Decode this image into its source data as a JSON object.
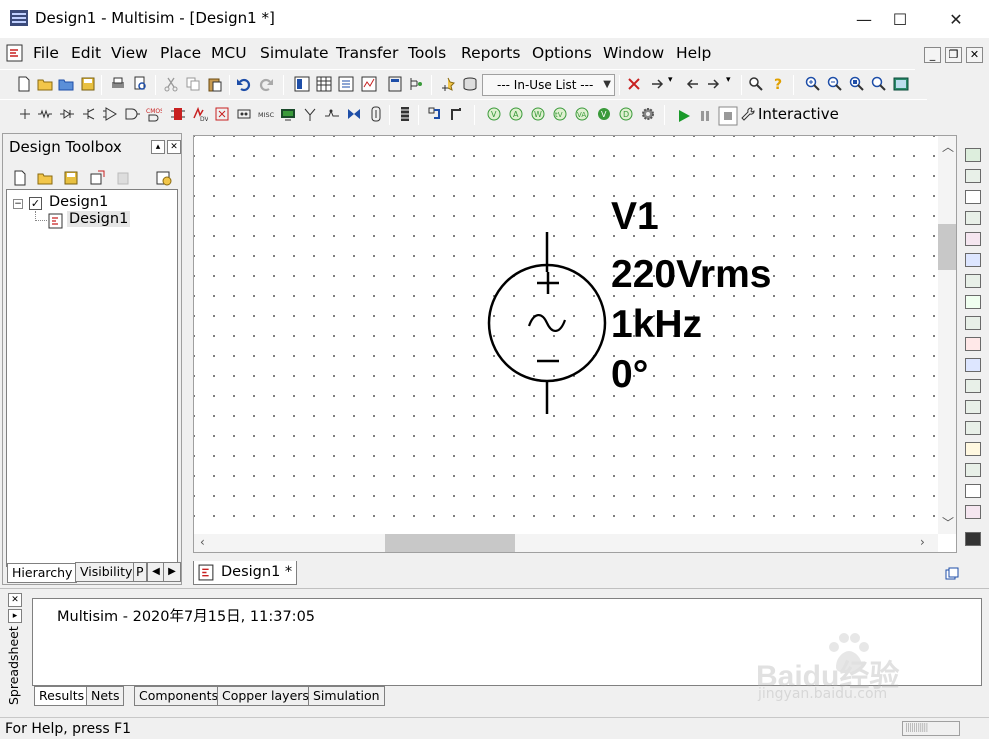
{
  "window": {
    "title": "Design1 - Multisim - [Design1 *]",
    "minimize_glyph": "—",
    "maximize_glyph": "☐",
    "close_glyph": "✕"
  },
  "menu": {
    "items": [
      "File",
      "Edit",
      "View",
      "Place",
      "MCU",
      "Simulate",
      "Transfer",
      "Tools",
      "Reports",
      "Options",
      "Window",
      "Help"
    ],
    "mdi_min": "_",
    "mdi_restore": "❐",
    "mdi_close": "✕"
  },
  "toolbar": {
    "inuse_list": "--- In-Use List ---",
    "interactive_label": "Interactive"
  },
  "toolbox": {
    "title": "Design Toolbox",
    "tree": {
      "root": "Design1",
      "child": "Design1"
    },
    "tabs": [
      "Hierarchy",
      "Visibility",
      "P"
    ]
  },
  "schematic": {
    "component": {
      "ref": "V1",
      "voltage": "220Vrms",
      "frequency": "1kHz",
      "phase": "0°",
      "plus": "+",
      "minus": "−"
    }
  },
  "document_tab": "Design1 *",
  "spreadsheet": {
    "side_label": "Spreadsheet",
    "message": "Multisim  -  2020年7月15日, 11:37:05",
    "tabs": [
      "Results",
      "Nets",
      "Components",
      "Copper layers",
      "Simulation"
    ]
  },
  "status": {
    "help_text": "For Help, press F1",
    "cell_text": "|||||||||||"
  },
  "watermark": {
    "brand": "Baidu经验",
    "url": "jingyan.baidu.com"
  },
  "colors": {
    "accent_blue": "#1e4ea8",
    "run_green": "#1a9a2a",
    "icon_red": "#c82020",
    "icon_green": "#3a9a3a",
    "canvas_dot": "#6a6a6a"
  }
}
